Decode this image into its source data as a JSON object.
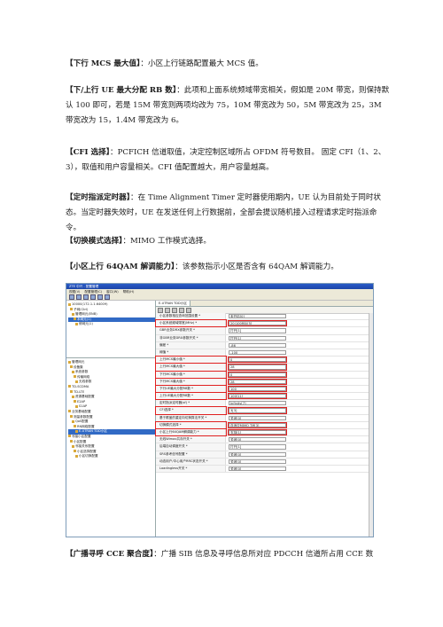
{
  "paragraphs": {
    "p1": {
      "title": "【下行 MCS 最大值】",
      "text": "：小区上行链路配置最大 MCS 值。"
    },
    "p2": {
      "title": "【下/上行 UE 最大分配 RB 数】",
      "text": "：此项和上面系统频域带宽相关，假如是 20M 带宽，则保持默认 100 即可，若是 15M 带宽则两项均改为 75，10M 带宽改为 50，5M 带宽改为 25，3M 带宽改为 15，1.4M 带宽改为 6。"
    },
    "p3": {
      "title": "【CFI 选择】",
      "text": "：PCFICH 信道取值，决定控制区域所占 OFDM 符号数目。 固定 CFI（1、2、3），取值和用户容量相关。CFI 值配置越大，用户容量越高。"
    },
    "p4": {
      "title": "【定时指派定时器】",
      "text": "：在 Time Alignment Timer 定时器使用期内，UE 认为目前处于同时状态。当定时器失效时，UE 在发送任何上行数据前，全部会提议随机接入过程请求定时指派命令。"
    },
    "p5": {
      "title": "【切换模式选择】",
      "text": "：MIMO 工作模式选择。"
    },
    "p6": {
      "title": "【小区上行 64QAM 解调能力】",
      "text": "：该参数指示小区是否含有 64QAM 解调能力。"
    },
    "p7": {
      "title": "【广播寻呼 CCE 聚合度】",
      "text": "：广播 SIB 信息及寻呼信息所对应 PDCCH 信道所占用 CCE 数"
    }
  },
  "screenshot": {
    "title": "ZTE 中兴 - 配置管理",
    "menu": [
      "视图(V)",
      "配置管理(C)",
      "窗口(W)",
      "帮助(H)"
    ],
    "tree_top": [
      {
        "label": "10000(172.1.1.64009)",
        "sel": false
      },
      {
        "label": "子网(Ctrl)",
        "sel": false
      },
      {
        "label": "管理网元(ENB)",
        "sel": false
      },
      {
        "label": "本网元(1)",
        "sel": true
      },
      {
        "label": "修网元(1)",
        "sel": false
      }
    ],
    "tree_bottom": [
      {
        "label": "管理网元",
        "sel": false
      },
      {
        "label": "设备集",
        "sel": false
      },
      {
        "label": "系统参数",
        "sel": false
      },
      {
        "label": "传输网络",
        "sel": false
      },
      {
        "label": "无线参数",
        "sel": false
      },
      {
        "label": "TD-SCDMA",
        "sel": false
      },
      {
        "label": "TD-LTE",
        "sel": false
      },
      {
        "label": "资源基础配置",
        "sel": false
      },
      {
        "label": "E2AP",
        "sel": false
      },
      {
        "label": "S1AP",
        "sel": false
      },
      {
        "label": "业务基础配置",
        "sel": false
      },
      {
        "label": "测量参数配置",
        "sel": false
      },
      {
        "label": "QoS配置",
        "sel": false
      },
      {
        "label": "RN网络配置",
        "sel": false
      },
      {
        "label": "E-UTRAN TDD小区",
        "sel": true
      },
      {
        "label": "邻接小区配置",
        "sel": false
      },
      {
        "label": "小区配置",
        "sel": false
      },
      {
        "label": "邻接关系配置",
        "sel": false
      },
      {
        "label": "小区选择配置",
        "sel": false
      },
      {
        "label": "小区切换配置",
        "sel": false
      }
    ],
    "tab": "E-UTRAN TDD小区",
    "rows": [
      {
        "name": "小区参数相应查询范围设置 *",
        "value": "未开启[0]",
        "hl": false
      },
      {
        "name": "小区系统频域带宽(MHz) *",
        "value": "20(100RB)[5]",
        "hl": true
      },
      {
        "name": "GBR业务DRX参数开关 *",
        "value": "打开[1]",
        "hl": false
      },
      {
        "name": "非GBR业务DRX参数开关 *",
        "value": "打开[1]",
        "hl": false
      },
      {
        "name": "偏差 *",
        "value": "-86",
        "hl": false
      },
      {
        "name": "阈值 *",
        "value": "-100",
        "hl": false
      },
      {
        "name": "上行MCS最小值 *",
        "value": "0",
        "hl": true
      },
      {
        "name": "上行MCS最大值 *",
        "value": "28",
        "hl": true
      },
      {
        "name": "下行MCS最小值 *",
        "value": "0",
        "hl": true
      },
      {
        "name": "下行MCS最大值 *",
        "value": "28",
        "hl": true
      },
      {
        "name": "下行UE最大分配RB数 *",
        "value": "100",
        "hl": true
      },
      {
        "name": "上行UE最大分配RB数 *",
        "value": "100[11]",
        "hl": true
      },
      {
        "name": "定时指派定时器(sf) *",
        "value": "Infinity[7]",
        "hl": false
      },
      {
        "name": "CFI选择 *",
        "value": "3[3]",
        "hl": true
      },
      {
        "name": "基于覆盖的重定向切换算法开关 *",
        "value": "关闭[0]",
        "hl": false
      },
      {
        "name": "切换模式选择 *",
        "value": "自适应MIMO TM[3]",
        "hl": true
      },
      {
        "name": "小区上行64QAM解调能力 *",
        "value": "支持[1]",
        "hl": true
      },
      {
        "name": "无线Wimax共存开关 *",
        "value": "关闭[0]",
        "hl": false
      },
      {
        "name": "后端自动调度开关 *",
        "value": "打开[1]",
        "hl": false
      },
      {
        "name": "SRS参考信号配置 *",
        "value": "关闭[0]",
        "hl": false
      },
      {
        "name": "动态用户/中心用户RRC状态开关 *",
        "value": "关闭[0]",
        "hl": false
      },
      {
        "name": "Loadingless开关 *",
        "value": "关闭[0]",
        "hl": false
      }
    ]
  },
  "colors": {
    "highlight": "#e02020",
    "selection": "#316ac5",
    "titlebar": "#2a5cc8"
  }
}
